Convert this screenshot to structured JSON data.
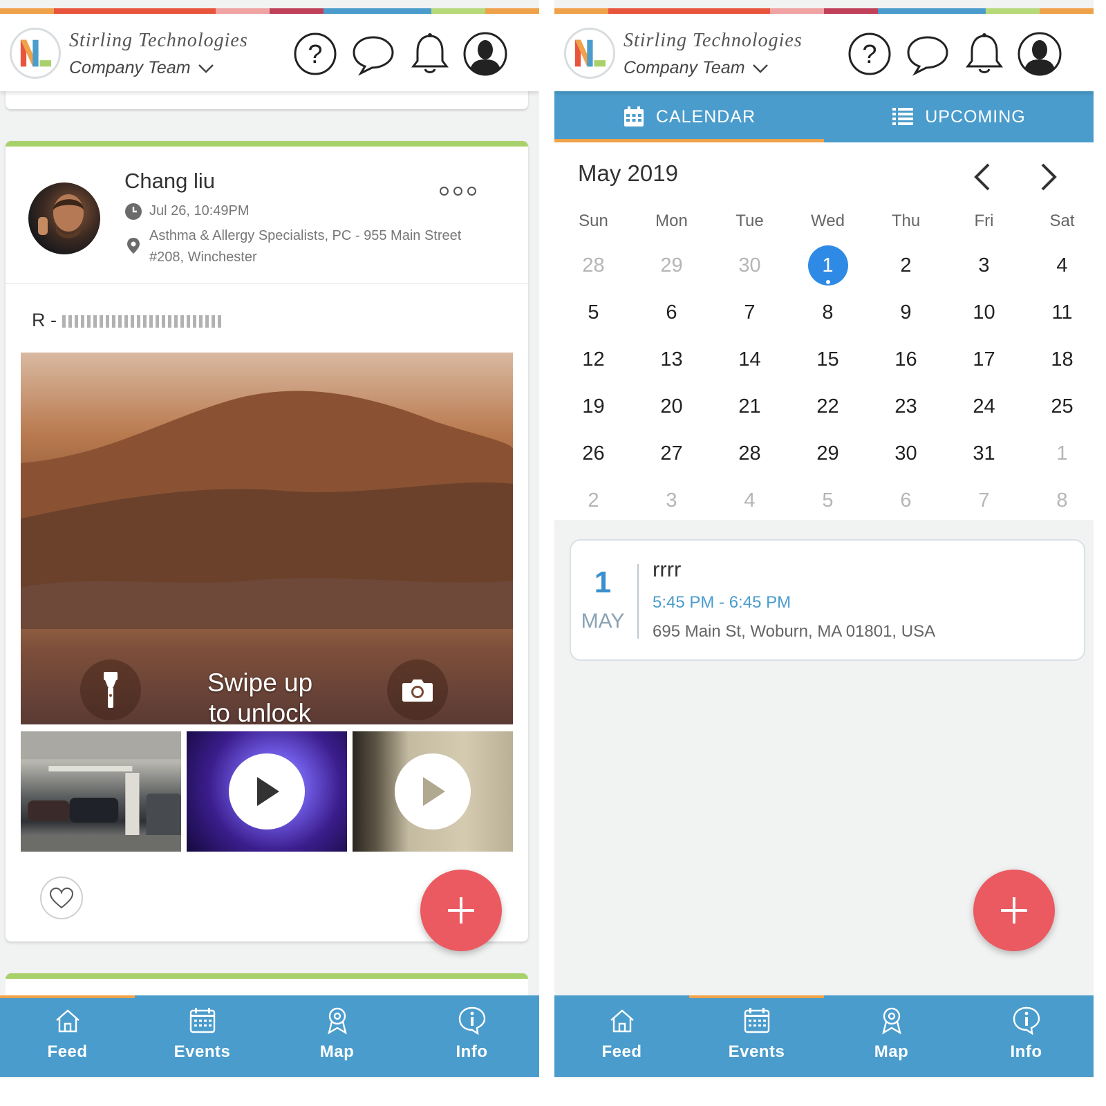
{
  "colors": {
    "accent_blue": "#4a9ccc",
    "active_orange": "#f0a24a",
    "fab_red": "#ea5a60",
    "post_green": "#a9d16b",
    "selected_blue": "#2f8ae6",
    "rainbow": [
      "#f0a24a",
      "#e8553c",
      "#e8553c",
      "#e8553c",
      "#f0a3a3",
      "#c0405a",
      "#4a9ccc",
      "#4a9ccc",
      "#b6d97a",
      "#f0a24a"
    ]
  },
  "header": {
    "company_name": "Stirling Technologies",
    "team_label": "Company Team",
    "icons": [
      "help-icon",
      "chat-icon",
      "bell-icon",
      "profile-icon"
    ]
  },
  "feed": {
    "post": {
      "author": "Chang liu",
      "timestamp": "Jul 26, 10:49PM",
      "location_line1": "Asthma & Allergy Specialists, PC - 955 Main Street",
      "location_line2": "#208, Winchester",
      "text_prefix": "R - ",
      "text_obscured": "with Brian Hanna",
      "photo_overlay_line1": "Swipe up",
      "photo_overlay_line2": "to unlock",
      "thumbnails": [
        {
          "kind": "photo",
          "subject": "parking garage"
        },
        {
          "kind": "video",
          "subject": "aquarium"
        },
        {
          "kind": "video",
          "subject": "doorway"
        }
      ]
    }
  },
  "tabbar": {
    "items": [
      {
        "label": "Feed",
        "icon": "home-icon"
      },
      {
        "label": "Events",
        "icon": "calendar-icon"
      },
      {
        "label": "Map",
        "icon": "map-pin-icon"
      },
      {
        "label": "Info",
        "icon": "info-icon"
      }
    ],
    "left_active": "Feed",
    "right_active": "Events"
  },
  "events": {
    "segments": [
      {
        "label": "CALENDAR",
        "icon": "calendar-grid-icon"
      },
      {
        "label": "UPCOMING",
        "icon": "list-icon"
      }
    ],
    "active_segment": "CALENDAR",
    "month_title": "May 2019",
    "weekdays": [
      "Sun",
      "Mon",
      "Tue",
      "Wed",
      "Thu",
      "Fri",
      "Sat"
    ],
    "weeks": [
      [
        "28",
        "29",
        "30",
        "1",
        "2",
        "3",
        "4"
      ],
      [
        "5",
        "6",
        "7",
        "8",
        "9",
        "10",
        "11"
      ],
      [
        "12",
        "13",
        "14",
        "15",
        "16",
        "17",
        "18"
      ],
      [
        "19",
        "20",
        "21",
        "22",
        "23",
        "24",
        "25"
      ],
      [
        "26",
        "27",
        "28",
        "29",
        "30",
        "31",
        "1"
      ],
      [
        "2",
        "3",
        "4",
        "5",
        "6",
        "7",
        "8"
      ]
    ],
    "muted_cells": [
      [
        0,
        0
      ],
      [
        0,
        1
      ],
      [
        0,
        2
      ],
      [
        4,
        6
      ],
      [
        5,
        0
      ],
      [
        5,
        1
      ],
      [
        5,
        2
      ],
      [
        5,
        3
      ],
      [
        5,
        4
      ],
      [
        5,
        5
      ],
      [
        5,
        6
      ]
    ],
    "selected_cell": [
      0,
      3
    ],
    "event": {
      "day": "1",
      "month": "MAY",
      "title": "rrrr",
      "time": "5:45 PM - 6:45 PM",
      "address": "695 Main St, Woburn, MA 01801, USA"
    }
  }
}
